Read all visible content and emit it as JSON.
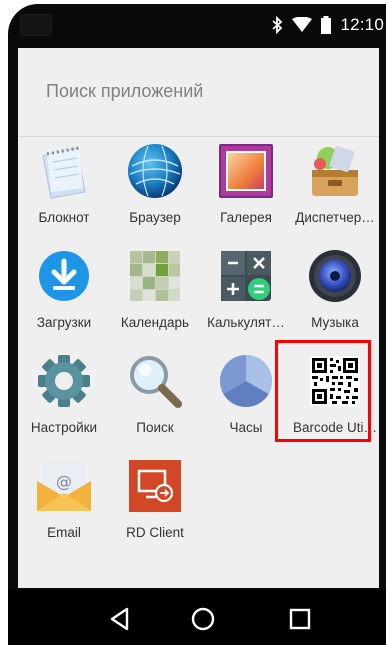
{
  "status_bar": {
    "time": "12:10",
    "icons": [
      "bluetooth-icon",
      "wifi-icon",
      "battery-icon"
    ]
  },
  "search": {
    "placeholder": "Поиск приложений"
  },
  "apps": [
    {
      "label": "Блокнот",
      "icon": "notepad-icon"
    },
    {
      "label": "Браузер",
      "icon": "browser-globe-icon"
    },
    {
      "label": "Галерея",
      "icon": "gallery-icon"
    },
    {
      "label": "Диспетчер…",
      "icon": "task-manager-icon"
    },
    {
      "label": "Загрузки",
      "icon": "downloads-icon"
    },
    {
      "label": "Календарь",
      "icon": "calendar-icon"
    },
    {
      "label": "Калькулят…",
      "icon": "calculator-icon"
    },
    {
      "label": "Музыка",
      "icon": "music-speaker-icon"
    },
    {
      "label": "Настройки",
      "icon": "settings-gear-icon"
    },
    {
      "label": "Поиск",
      "icon": "search-magnifier-icon"
    },
    {
      "label": "Часы",
      "icon": "clock-icon"
    },
    {
      "label": "Barcode Uti…",
      "icon": "qr-code-icon"
    },
    {
      "label": "Email",
      "icon": "email-icon"
    },
    {
      "label": "RD Client",
      "icon": "remote-desktop-icon"
    }
  ],
  "highlighted_app": "Barcode Uti…",
  "nav_bar": {
    "buttons": [
      "back-icon",
      "home-icon",
      "recents-icon"
    ]
  },
  "colors": {
    "highlight": "#ff0000",
    "drawer_bg": "#efefef",
    "navbar_bg": "#000000"
  }
}
